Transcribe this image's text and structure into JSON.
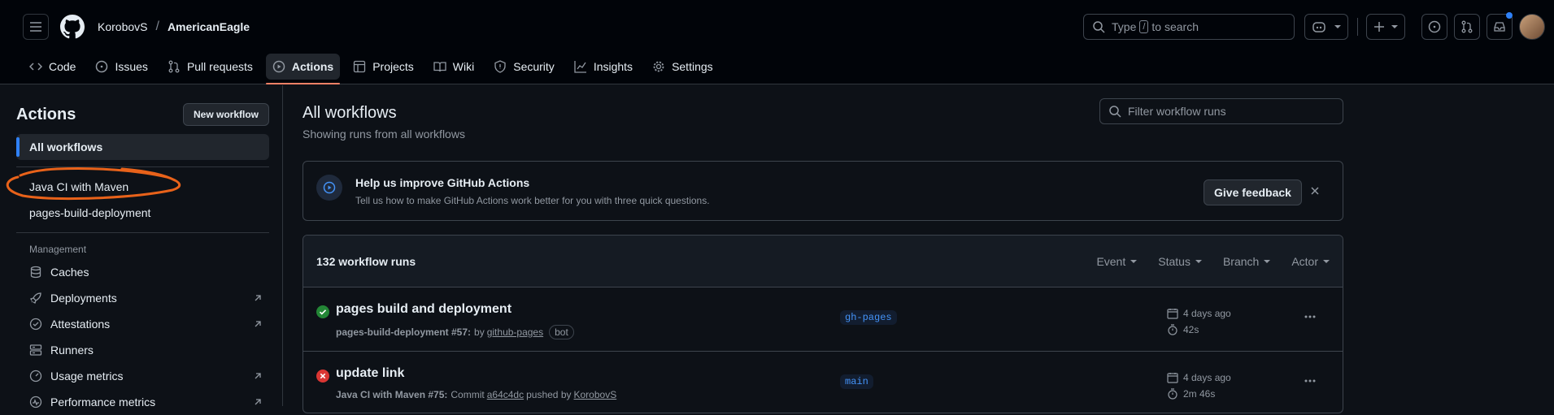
{
  "header": {
    "owner": "KorobovS",
    "separator": "/",
    "repo": "AmericanEagle",
    "search_prefix": "Type",
    "search_key": "/",
    "search_suffix": "to search"
  },
  "tabs": [
    {
      "label": "Code"
    },
    {
      "label": "Issues"
    },
    {
      "label": "Pull requests"
    },
    {
      "label": "Actions"
    },
    {
      "label": "Projects"
    },
    {
      "label": "Wiki"
    },
    {
      "label": "Security"
    },
    {
      "label": "Insights"
    },
    {
      "label": "Settings"
    }
  ],
  "sidebar": {
    "title": "Actions",
    "new_workflow": "New workflow",
    "all_workflows": "All workflows",
    "workflows": [
      "Java CI with Maven",
      "pages-build-deployment"
    ],
    "management_label": "Management",
    "management": [
      "Caches",
      "Deployments",
      "Attestations",
      "Runners",
      "Usage metrics",
      "Performance metrics"
    ]
  },
  "main": {
    "title": "All workflows",
    "subtitle": "Showing runs from all workflows",
    "filter_placeholder": "Filter workflow runs",
    "banner": {
      "title": "Help us improve GitHub Actions",
      "text": "Tell us how to make GitHub Actions work better for you with three quick questions.",
      "button": "Give feedback"
    },
    "runs_count": "132 workflow runs",
    "filters": [
      "Event",
      "Status",
      "Branch",
      "Actor"
    ],
    "runs": [
      {
        "status": "success",
        "title": "pages build and deployment",
        "workflow": "pages-build-deployment #57:",
        "by": "by",
        "actor": "github-pages",
        "badge": "bot",
        "branch": "gh-pages",
        "when": "4 days ago",
        "duration": "42s"
      },
      {
        "status": "failure",
        "title": "update link",
        "workflow": "Java CI with Maven #75:",
        "commit_label": "Commit",
        "commit": "a64c4dc",
        "pushed_by": "pushed by",
        "actor": "KorobovS",
        "branch": "main",
        "when": "4 days ago",
        "duration": "2m 46s"
      }
    ]
  },
  "colors": {
    "accent": "#2f81f7",
    "annotation": "#e8621a",
    "success": "#238636",
    "failure": "#da3633"
  }
}
